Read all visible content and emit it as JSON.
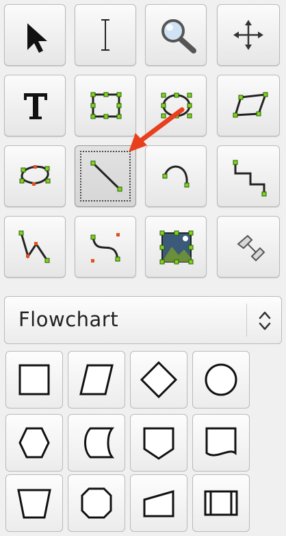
{
  "toolbox": {
    "tools": [
      {
        "name": "pointer-tool",
        "icon": "arrow-pointer-icon"
      },
      {
        "name": "text-cursor-tool",
        "icon": "ibeam-icon"
      },
      {
        "name": "zoom-tool",
        "icon": "magnifier-icon"
      },
      {
        "name": "move-tool",
        "icon": "four-way-arrows-icon"
      },
      {
        "name": "text-tool",
        "icon": "text-t-icon"
      },
      {
        "name": "box-tool",
        "icon": "box-icon"
      },
      {
        "name": "ellipse-tool",
        "icon": "ellipse-icon"
      },
      {
        "name": "polygon-tool",
        "icon": "parallelogram-icon"
      },
      {
        "name": "beziergon-tool",
        "icon": "beziergon-icon"
      },
      {
        "name": "line-tool",
        "icon": "line-icon",
        "selected": true
      },
      {
        "name": "arc-tool",
        "icon": "arc-icon"
      },
      {
        "name": "zigzag-line-tool",
        "icon": "zigzag-line-icon"
      },
      {
        "name": "polyline-tool",
        "icon": "polyline-icon"
      },
      {
        "name": "bezier-line-tool",
        "icon": "bezier-line-icon"
      },
      {
        "name": "image-tool",
        "icon": "image-icon"
      },
      {
        "name": "outline-tool",
        "icon": "outline-icon"
      }
    ]
  },
  "sheet_selector": {
    "selected": "Flowchart",
    "icon": "updown-chevron-icon"
  },
  "shapes": [
    {
      "name": "process-shape",
      "icon": "square-icon"
    },
    {
      "name": "input-output-shape",
      "icon": "parallelogram-icon"
    },
    {
      "name": "decision-shape",
      "icon": "diamond-icon"
    },
    {
      "name": "connector-shape",
      "icon": "circle-icon"
    },
    {
      "name": "preparation-shape",
      "icon": "hexagon-icon"
    },
    {
      "name": "stored-data-shape",
      "icon": "stored-data-icon"
    },
    {
      "name": "off-page-connector-shape",
      "icon": "pentagon-icon"
    },
    {
      "name": "document-shape",
      "icon": "document-icon"
    },
    {
      "name": "manual-operation-shape",
      "icon": "trapezoid-icon"
    },
    {
      "name": "loop-limit-shape",
      "icon": "octagon-icon"
    },
    {
      "name": "manual-input-shape",
      "icon": "manual-input-icon"
    },
    {
      "name": "predefined-process-shape",
      "icon": "predefined-process-icon"
    }
  ],
  "annotation": {
    "icon": "red-arrow-icon",
    "color": "#e8401c"
  }
}
